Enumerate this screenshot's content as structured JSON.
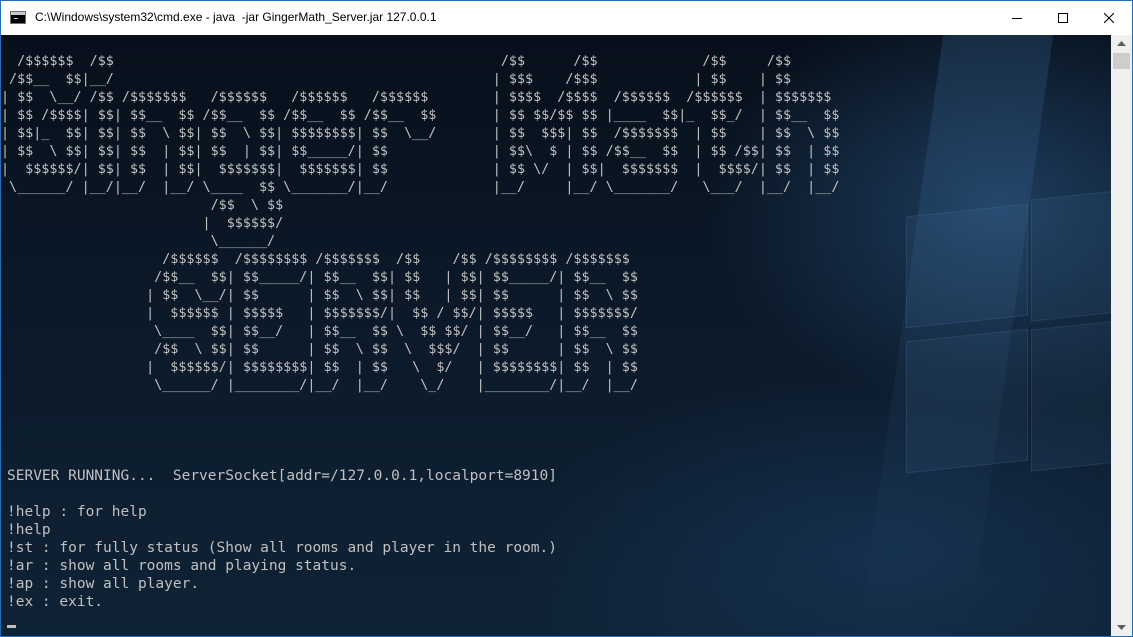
{
  "window": {
    "title": "C:\\Windows\\system32\\cmd.exe - java  -jar GingerMath_Server.jar 127.0.0.1",
    "icon": "cmd-icon",
    "controls": [
      "minimize-icon",
      "maximize-icon",
      "close-icon"
    ]
  },
  "console": {
    "banner_lines": [
      "  /$$$$$$  /$$                                                /$$      /$$             /$$     /$$",
      " /$$__  $$|__/                                               | $$$    /$$$            | $$    | $$",
      "| $$  \\__/ /$$ /$$$$$$$   /$$$$$$   /$$$$$$   /$$$$$$        | $$$$  /$$$$  /$$$$$$  /$$$$$$  | $$$$$$$",
      "| $$ /$$$$| $$| $$__  $$ /$$__  $$ /$$__  $$ /$$__  $$       | $$ $$/$$ $$ |____  $$|_  $$_/  | $$__  $$",
      "| $$|_  $$| $$| $$  \\ $$| $$  \\ $$| $$$$$$$$| $$  \\__/       | $$  $$$| $$  /$$$$$$$  | $$    | $$  \\ $$",
      "| $$  \\ $$| $$| $$  | $$| $$  | $$| $$_____/| $$             | $$\\  $ | $$ /$$__  $$  | $$ /$$| $$  | $$",
      "|  $$$$$$/| $$| $$  | $$|  $$$$$$$|  $$$$$$$| $$             | $$ \\/  | $$|  $$$$$$$  |  $$$$/| $$  | $$",
      " \\______/ |__/|__/  |__/ \\____  $$ \\_______/|__/             |__/     |__/ \\_______/   \\___/  |__/  |__/",
      "                          /$$  \\ $$",
      "                         |  $$$$$$/",
      "                          \\______/",
      "                    /$$$$$$  /$$$$$$$$ /$$$$$$$  /$$    /$$ /$$$$$$$$ /$$$$$$$",
      "                   /$$__  $$| $$_____/| $$__  $$| $$   | $$| $$_____/| $$__  $$",
      "                  | $$  \\__/| $$      | $$  \\ $$| $$   | $$| $$      | $$  \\ $$",
      "                  |  $$$$$$ | $$$$$   | $$$$$$$/|  $$ / $$/| $$$$$   | $$$$$$$/",
      "                   \\____  $$| $$__/   | $$__  $$ \\  $$ $$/ | $$__/   | $$__  $$",
      "                   /$$  \\ $$| $$      | $$  \\ $$  \\  $$$/  | $$      | $$  \\ $$",
      "                  |  $$$$$$/| $$$$$$$$| $$  | $$   \\  $/   | $$$$$$$$| $$  | $$",
      "                   \\______/ |________/|__/  |__/    \\_/    |________/|__/  |__/"
    ],
    "status_line": "SERVER RUNNING...  ServerSocket[addr=/127.0.0.1,localport=8910]",
    "output_lines": [
      "!help : for help",
      "!help",
      "!st : for fully status (Show all rooms and player in the room.)",
      "!ar : show all rooms and playing status.",
      "!ap : show all player.",
      "!ex : exit."
    ]
  },
  "colors": {
    "console_text": "#c0c0c0",
    "titlebar_bg": "#ffffff",
    "window_border": "#1e6fbf"
  }
}
